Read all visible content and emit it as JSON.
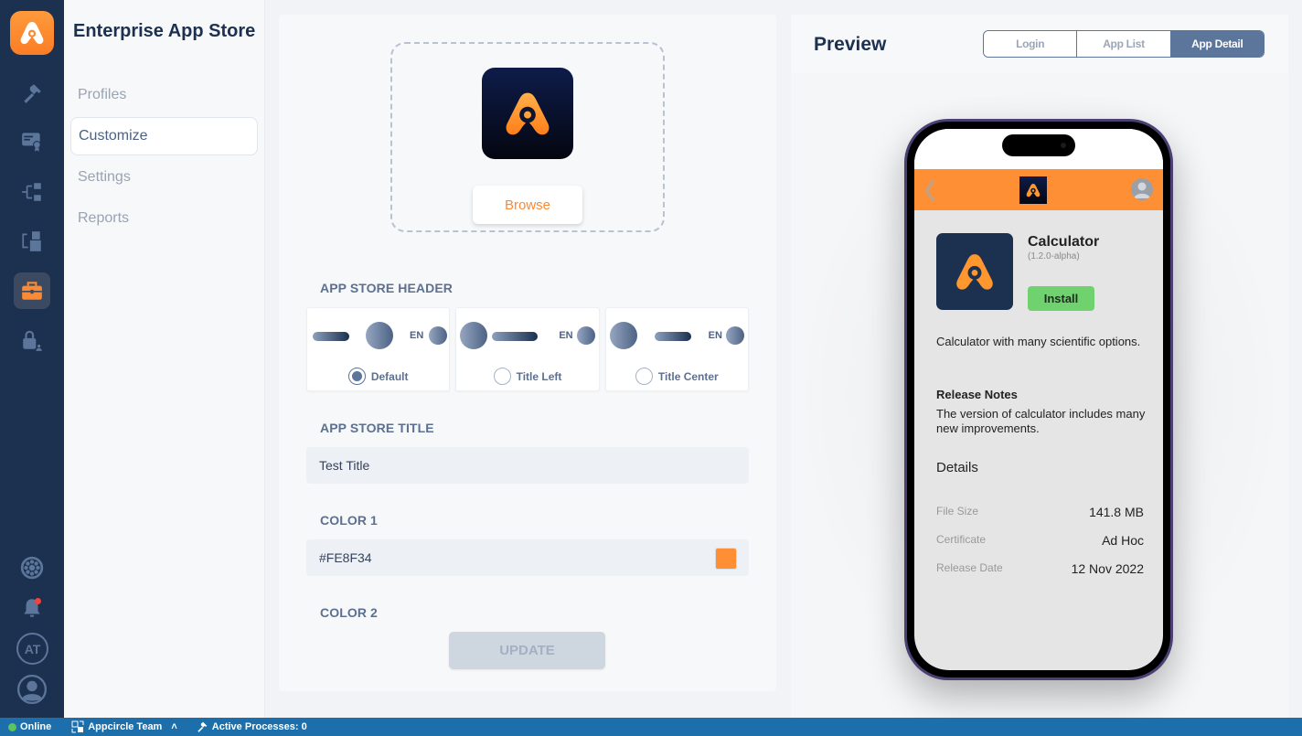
{
  "app": {
    "title": "Enterprise App Store"
  },
  "sidebar": {
    "items": [
      {
        "label": "Profiles",
        "active": false
      },
      {
        "label": "Customize",
        "active": true
      },
      {
        "label": "Settings",
        "active": false
      },
      {
        "label": "Reports",
        "active": false
      }
    ]
  },
  "rail": {
    "icons": [
      "appcircle-logo",
      "hammer-icon",
      "certificate-icon",
      "distribution-icon",
      "workflow-icon",
      "briefcase-icon",
      "lock-user-icon",
      "settings-wheel-icon",
      "bell-icon",
      "user-icon"
    ],
    "active": "briefcase-icon",
    "org_initials": "AT",
    "has_notification": true
  },
  "customize": {
    "logo_upload": {
      "browse_label": "Browse"
    },
    "header_section": {
      "label": "APP STORE HEADER",
      "options": [
        {
          "label": "Default",
          "selected": true,
          "en_label": "EN"
        },
        {
          "label": "Title Left",
          "selected": false,
          "en_label": "EN"
        },
        {
          "label": "Title Center",
          "selected": false,
          "en_label": "EN"
        }
      ]
    },
    "title_section": {
      "label": "APP STORE TITLE",
      "value": "Test Title"
    },
    "color1": {
      "label": "COLOR 1",
      "value": "#FE8F34",
      "swatch": "#FE8F34"
    },
    "color2": {
      "label": "COLOR 2"
    },
    "update_label": "UPDATE"
  },
  "preview": {
    "title": "Preview",
    "tabs": [
      {
        "label": "Login",
        "active": false
      },
      {
        "label": "App List",
        "active": false
      },
      {
        "label": "App Detail",
        "active": true
      }
    ],
    "phone": {
      "header_color": "#FE8F34",
      "app": {
        "name": "Calculator",
        "version": "(1.2.0-alpha)",
        "install_label": "Install",
        "description": "Calculator with many scientific options.",
        "release_notes_title": "Release Notes",
        "release_notes": "The version of calculator includes many new improvements.",
        "details_title": "Details",
        "details": [
          {
            "key": "File Size",
            "value": "141.8 MB"
          },
          {
            "key": "Certificate",
            "value": "Ad Hoc"
          },
          {
            "key": "Release Date",
            "value": "12 Nov 2022"
          }
        ]
      }
    }
  },
  "statusbar": {
    "online": "Online",
    "team": "Appcircle Team",
    "processes": "Active Processes: 0"
  }
}
